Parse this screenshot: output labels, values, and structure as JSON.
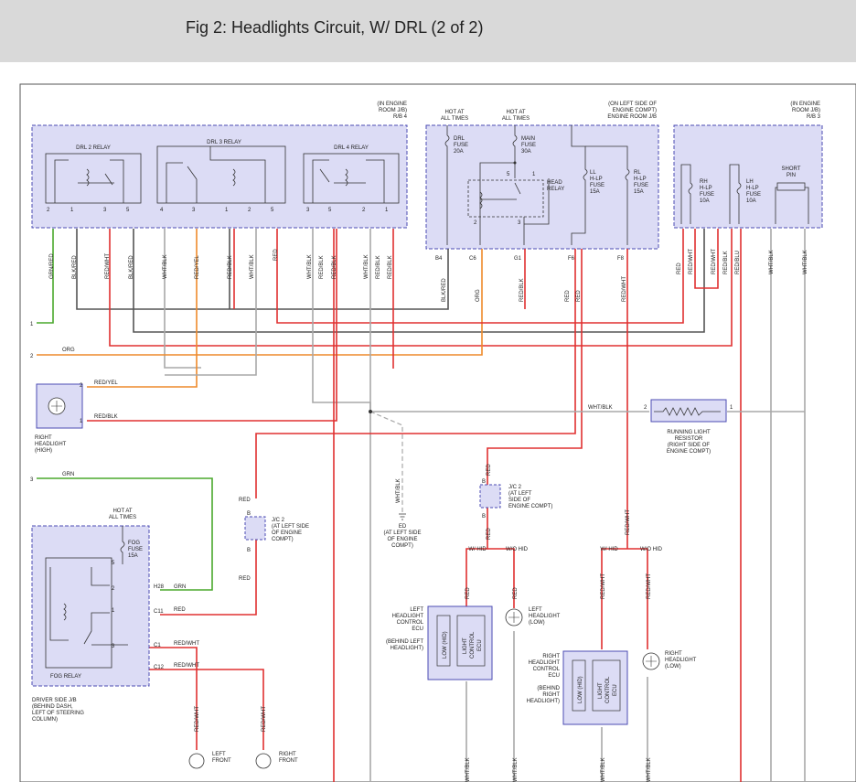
{
  "title": "Fig 2: Headlights Circuit, W/ DRL (2 of 2)",
  "colors": {
    "box_fill": "#dcdcf5",
    "box_stroke": "#4b4bb3",
    "red": "#e03030",
    "orange": "#ee8a2b",
    "green": "#4aa82d",
    "gray": "#a8a8a8",
    "dark": "#333333",
    "header_bg": "#d9d9d9"
  },
  "rb4": {
    "location": [
      "(IN ENGINE",
      "ROOM J/B)",
      "R/B 4"
    ],
    "drl2": "DRL 2 RELAY",
    "drl3": "DRL 3 RELAY",
    "drl4": "DRL 4 RELAY",
    "pins": [
      "2",
      "1",
      "3",
      "5",
      "4",
      "3",
      "1",
      "2",
      "5",
      "3",
      "5",
      "2",
      "1"
    ]
  },
  "enginejb": {
    "location": [
      "(ON LEFT SIDE OF",
      "ENGINE COMPT)",
      "ENGINE ROOM J/B"
    ],
    "hot1": [
      "HOT AT",
      "ALL TIMES"
    ],
    "hot2": [
      "HOT AT",
      "ALL TIMES"
    ],
    "drl_fuse": [
      "DRL",
      "FUSE",
      "20A"
    ],
    "main_fuse": [
      "MAIN",
      "FUSE",
      "30A"
    ],
    "head_relay": [
      "HEAD",
      "RELAY"
    ],
    "ll_fuse": [
      "LL",
      "H-LP",
      "FUSE",
      "15A"
    ],
    "rl_fuse": [
      "RL",
      "H-LP",
      "FUSE",
      "15A"
    ],
    "connectors": [
      "B4",
      "C6",
      "G1",
      "F6",
      "F8"
    ],
    "relay_pins": [
      "5",
      "1",
      "2",
      "3"
    ]
  },
  "rb3": {
    "location": [
      "(IN ENGINE",
      "ROOM J/B)",
      "R/B 3"
    ],
    "rh_fuse": [
      "RH",
      "H-LP",
      "FUSE",
      "10A"
    ],
    "lh_fuse": [
      "LH",
      "H-LP",
      "FUSE",
      "10A"
    ],
    "short_pin": [
      "SHORT",
      "PIN"
    ]
  },
  "wire_labels": {
    "grn_red": "GRN/RED",
    "blk_red": "BLK/RED",
    "red_wht": "RED/WHT",
    "wht_blk": "WHT/BLK",
    "red_yel": "RED/YEL",
    "red": "RED",
    "red_blk": "RED/BLK",
    "orn": "ORG",
    "red_blu": "RED/BLU",
    "grn": "GRN",
    "org": "ORG"
  },
  "left_numbers": [
    "1",
    "2",
    "3"
  ],
  "right_headlight_high": {
    "label": [
      "RIGHT",
      "HEADLIGHT",
      "(HIGH)"
    ],
    "pin2_wire": "RED/YEL",
    "pin1_wire": "RED/BLK"
  },
  "running_light_resistor": {
    "label": [
      "RUNNING LIGHT",
      "RESISTOR",
      "(RIGHT SIDE OF",
      "ENGINE COMPT)"
    ],
    "wire": "WHT/BLK"
  },
  "jc2_left": {
    "label": [
      "J/C 2",
      "(AT LEFT SIDE",
      "OF ENGINE",
      "COMPT)"
    ]
  },
  "jc2_right": {
    "label": [
      "J/C 2",
      "(AT LEFT",
      "SIDE OF",
      "ENGINE COMPT)"
    ]
  },
  "ground": {
    "label": [
      "ED",
      "(AT LEFT SIDE",
      "OF ENGINE",
      "COMPT)"
    ]
  },
  "fog": {
    "hot": [
      "HOT AT",
      "ALL TIMES"
    ],
    "fuse": [
      "FOG",
      "FUSE",
      "15A"
    ],
    "relay": "FOG RELAY",
    "jb": [
      "DRIVER SIDE J/B",
      "(BEHIND DASH,",
      "LEFT OF STEERING",
      "COLUMN)"
    ],
    "connectors": [
      "H28",
      "C11",
      "C1",
      "C12"
    ],
    "wires": [
      "GRN",
      "RED",
      "RED/WHT",
      "RED/WHT"
    ]
  },
  "with_hid": "W/ HID",
  "without_hid": "W/O HID",
  "left_ecu": {
    "label": [
      "LEFT",
      "HEADLIGHT",
      "CONTROL",
      "ECU",
      "(BEHIND LEFT",
      "HEADLIGHT)"
    ],
    "inner": [
      "LOW (HID)",
      "LIGHT",
      "CONTROL",
      "ECU"
    ]
  },
  "right_ecu": {
    "label": [
      "RIGHT",
      "HEADLIGHT",
      "CONTROL",
      "ECU",
      "(BEHIND",
      "RIGHT",
      "HEADLIGHT)"
    ],
    "inner": [
      "LOW (HID)",
      "LIGHT",
      "CONTROL",
      "ECU"
    ]
  },
  "left_low": [
    "LEFT",
    "HEADLIGHT",
    "(LOW)"
  ],
  "right_low": [
    "RIGHT",
    "HEADLIGHT",
    "(LOW)"
  ],
  "left_front": [
    "LEFT",
    "FRONT"
  ],
  "right_front": [
    "RIGHT",
    "FRONT"
  ]
}
